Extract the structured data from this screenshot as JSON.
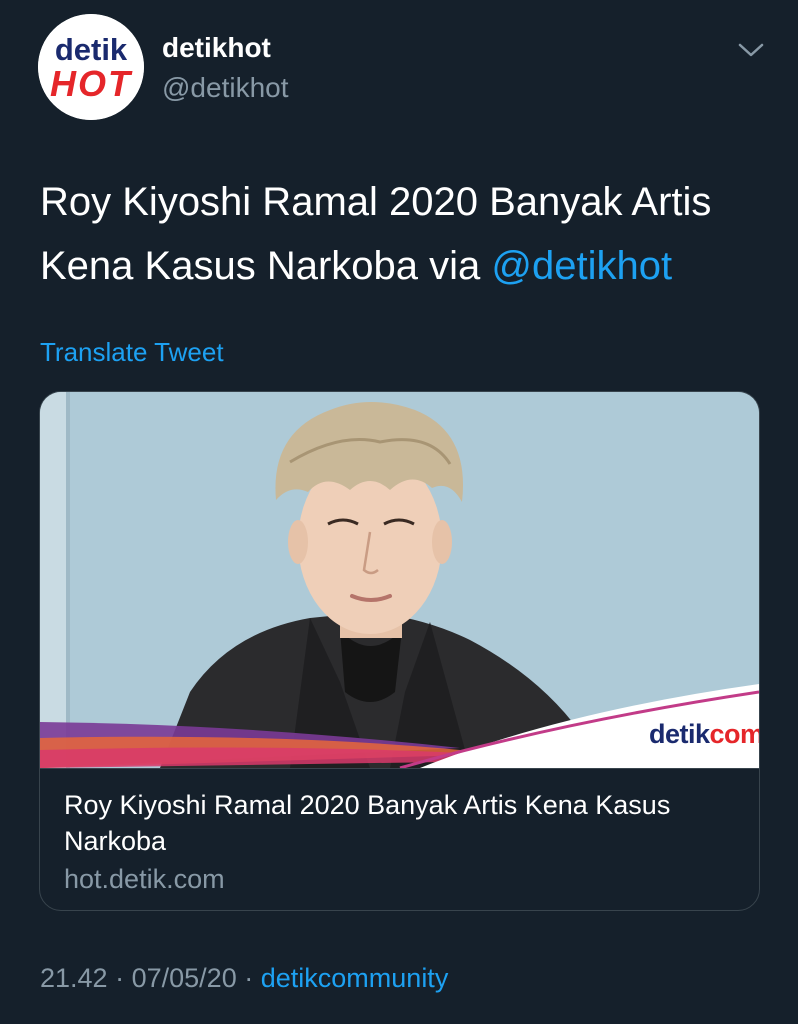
{
  "author": {
    "avatar_text_top": "detik",
    "avatar_text_bottom": "HOT",
    "display_name": "detikhot",
    "handle": "@detikhot"
  },
  "tweet": {
    "text": "Roy Kiyoshi Ramal 2020 Banyak Artis Kena Kasus Narkoba via",
    "mention": "@detikhot",
    "translate_label": "Translate Tweet"
  },
  "card": {
    "image_brand_main": "detik",
    "image_brand_suffix": "com",
    "title": "Roy Kiyoshi Ramal 2020 Banyak Artis Kena Kasus Narkoba",
    "domain": "hot.detik.com"
  },
  "meta": {
    "time": "21.42",
    "separator": "·",
    "date": "07/05/20",
    "source": "detikcommunity"
  },
  "icons": {
    "menu": "chevron-down-icon"
  },
  "colors": {
    "background": "#15202b",
    "accent": "#1da1f2",
    "secondary_text": "#8899a6",
    "border": "#38444d"
  }
}
